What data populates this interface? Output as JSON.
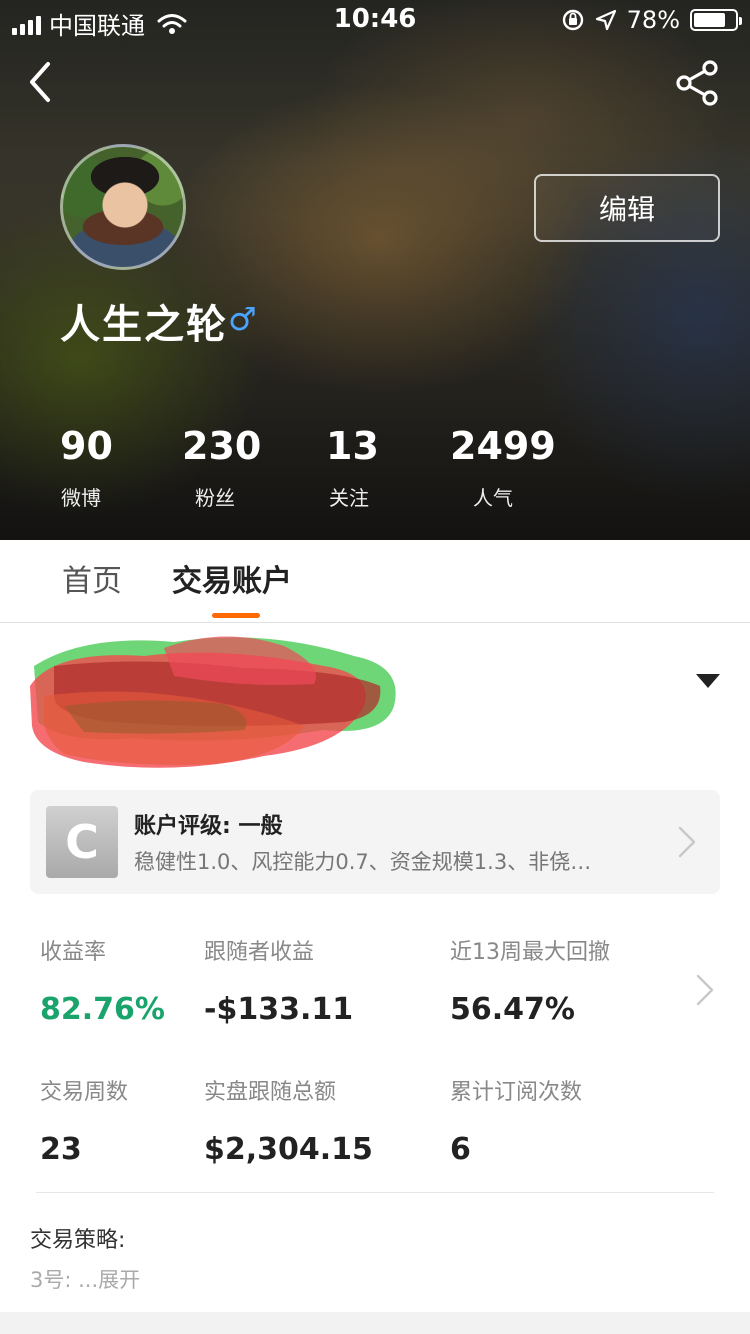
{
  "status_bar": {
    "carrier": "中国联通",
    "time": "10:46",
    "battery_pct": "78%",
    "battery_level": 0.78
  },
  "icons": {
    "back": "chevron-left-icon",
    "share": "share-icon",
    "dropdown": "caret-down-icon",
    "chevron": "chevron-right-icon"
  },
  "profile": {
    "name": "人生之轮",
    "gender_symbol": "♂",
    "edit_label": "编辑"
  },
  "stats": [
    {
      "value": "90",
      "label": "微博"
    },
    {
      "value": "230",
      "label": "粉丝"
    },
    {
      "value": "13",
      "label": "关注"
    },
    {
      "value": "2499",
      "label": "人气"
    }
  ],
  "tabs": [
    {
      "label": "首页",
      "active": false
    },
    {
      "label": "交易账户",
      "active": true
    }
  ],
  "rating": {
    "grade": "C",
    "title": "账户评级: 一般",
    "description": "稳健性1.0、风控能力0.7、资金规模1.3、非侥…"
  },
  "metrics": [
    {
      "label": "收益率",
      "value": "82.76%"
    },
    {
      "label": "跟随者收益",
      "value": "-$133.11"
    },
    {
      "label": "近13周最大回撤",
      "value": "56.47%"
    },
    {
      "label": "交易周数",
      "value": "23"
    },
    {
      "label": "实盘跟随总额",
      "value": "$2,304.15"
    },
    {
      "label": "累计订阅次数",
      "value": "6"
    }
  ],
  "strategy": {
    "title": "交易策略:",
    "text": "3号:  ...",
    "expand_label": "展开"
  },
  "colors": {
    "accent": "#ff6a00",
    "positive": "#1aa36b",
    "gender": "#4aa3ff"
  }
}
